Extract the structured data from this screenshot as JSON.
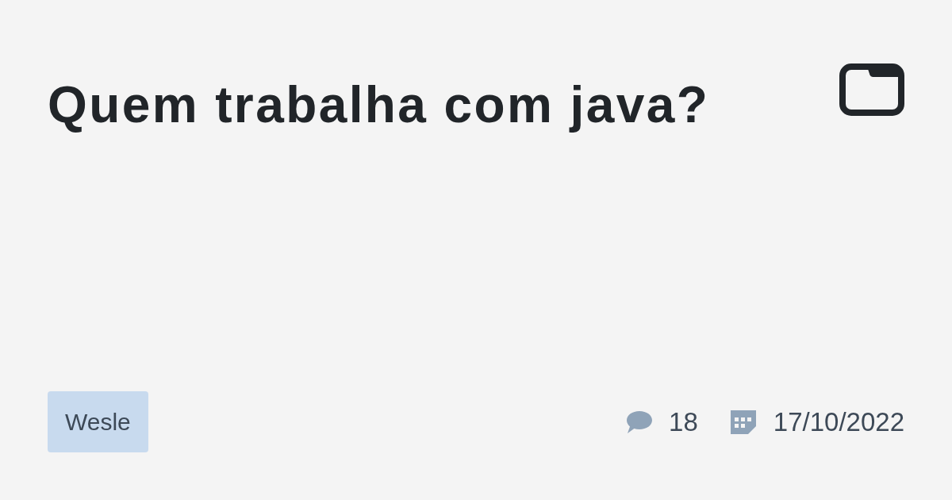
{
  "title": "Quem trabalha com java?",
  "author_tag": "Wesle",
  "stats": {
    "comments": "18",
    "date": "17/10/2022"
  }
}
